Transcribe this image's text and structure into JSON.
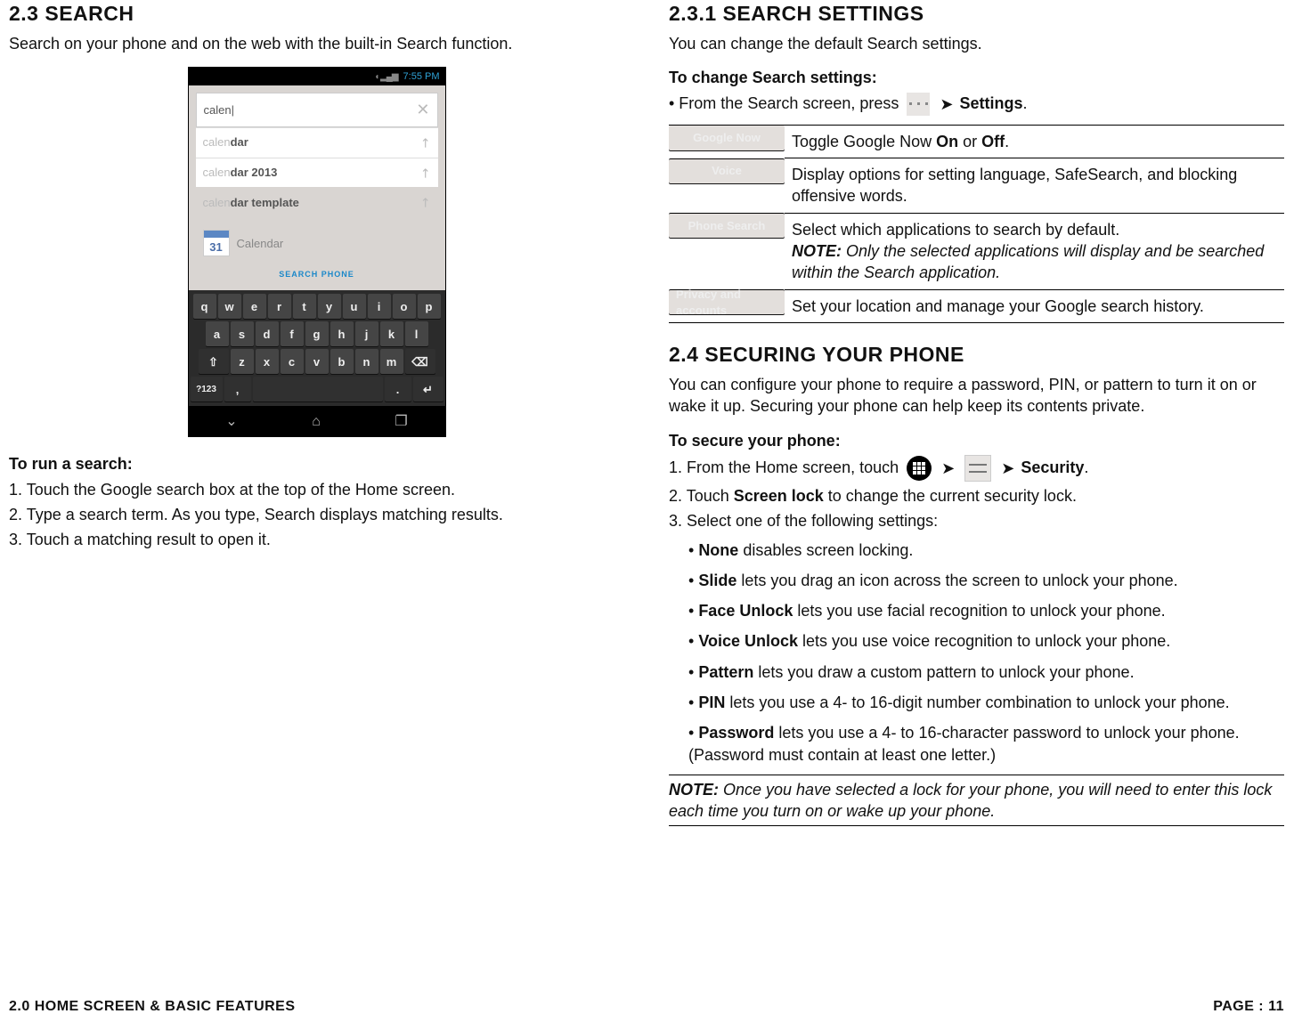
{
  "col1": {
    "heading": "2.3 SEARCH",
    "intro": "Search on your phone and on the web with the built-in Search function.",
    "run_heading": "To run a search:",
    "steps": [
      "1. Touch the Google search box at the top of the Home screen.",
      "2. Type a search term. As you type, Search displays matching results.",
      "3. Touch a matching result to open it."
    ],
    "phone": {
      "time": "7:55 PM",
      "typed_prefix": "calen",
      "typed_cursor": "|",
      "suggestions": [
        {
          "match": "calen",
          "rest": "dar"
        },
        {
          "match": "calen",
          "rest": "dar 2013"
        },
        {
          "match": "calen",
          "rest": "dar template"
        }
      ],
      "app_result": {
        "day": "31",
        "label": "Calendar"
      },
      "link": "SEARCH PHONE",
      "rows": {
        "r1": [
          "q",
          "w",
          "e",
          "r",
          "t",
          "y",
          "u",
          "i",
          "o",
          "p"
        ],
        "r2": [
          "a",
          "s",
          "d",
          "f",
          "g",
          "h",
          "j",
          "k",
          "l"
        ],
        "r3": [
          "z",
          "x",
          "c",
          "v",
          "b",
          "n",
          "m"
        ]
      },
      "sym": "?123",
      "comma": ",",
      "dot": "."
    }
  },
  "col2": {
    "h1": "2.3.1 SEARCH SETTINGS",
    "intro": "You can change the default Search settings.",
    "change_heading": "To change Search settings:",
    "change_line_a": "• From the Search screen, press ",
    "change_line_b": "Settings",
    "change_line_c": ".",
    "table": [
      {
        "k": "Google Now",
        "v_pre": "Toggle Google Now ",
        "v_b1": "On",
        "v_mid": " or ",
        "v_b2": "Off",
        "v_post": "."
      },
      {
        "k": "Voice",
        "text": "Display options for setting language, SafeSearch, and blocking offensive words."
      },
      {
        "k": "Phone Search",
        "text": "Select which applications to search by default.",
        "note_b": "NOTE:",
        "note": " Only the selected applications will display and be searched within the Search application."
      },
      {
        "k": "Privacy and accounts",
        "text": "Set your location and manage your Google search history."
      }
    ],
    "h2": "2.4 SECURING YOUR PHONE",
    "sec_intro": "You can configure your phone to require a password, PIN, or pattern to turn it on or wake it up. Securing your phone can help keep its contents private.",
    "secure_heading": "To secure your phone:",
    "step1_a": "1. From the Home screen, touch ",
    "step1_b": "Security",
    "step1_c": ".",
    "step2_a": "2. Touch ",
    "step2_b": "Screen lock",
    "step2_c": " to change the current security lock.",
    "step3": "3. Select one of the following settings:",
    "opts": [
      {
        "b": "None",
        "t": " disables screen locking."
      },
      {
        "b": "Slide",
        "t": " lets you drag an icon across the screen to unlock your phone."
      },
      {
        "b": "Face Unlock",
        "t": " lets you use facial recognition to unlock your phone."
      },
      {
        "b": "Voice Unlock",
        "t": " lets you use voice recognition to unlock your phone."
      },
      {
        "b": "Pattern",
        "t": " lets you draw a custom pattern to unlock your phone."
      },
      {
        "b": "PIN",
        "t": " lets you use a 4- to 16-digit number combination to unlock your phone."
      },
      {
        "b": "Password",
        "t": " lets you use a 4- to 16-character password to unlock your phone. (Password must contain at least one letter.)"
      }
    ],
    "note_b": "NOTE:",
    "note": " Once you have selected a lock for your phone, you will need to enter this lock each time you turn on or wake up your phone."
  },
  "footer": {
    "left": "2.0 HOME SCREEN & BASIC FEATURES",
    "right": "PAGE : 11"
  }
}
